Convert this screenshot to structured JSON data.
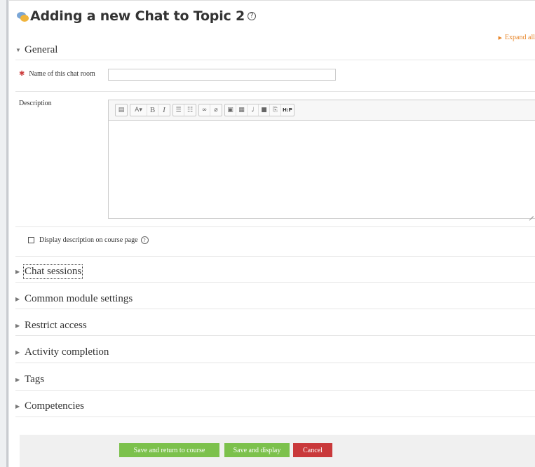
{
  "title": "Adding a new Chat to Topic 2",
  "expand_all": "Expand all",
  "general": {
    "header": "General",
    "name_label": "Name of this chat room",
    "name_value": "",
    "description_label": "Description",
    "display_description_label": "Display description on course page"
  },
  "editor_toolbar": {
    "font_button": "A▾",
    "bold": "B",
    "italic": "I",
    "h5p": "H:P"
  },
  "sections": [
    {
      "label": "Chat sessions"
    },
    {
      "label": "Common module settings"
    },
    {
      "label": "Restrict access"
    },
    {
      "label": "Activity completion"
    },
    {
      "label": "Tags"
    },
    {
      "label": "Competencies"
    }
  ],
  "buttons": {
    "save_return": "Save and return to course",
    "save_display": "Save and display",
    "cancel": "Cancel"
  },
  "colors": {
    "accent": "#e8862a",
    "primary_button": "#7cc14c",
    "cancel_button": "#c9393b"
  }
}
